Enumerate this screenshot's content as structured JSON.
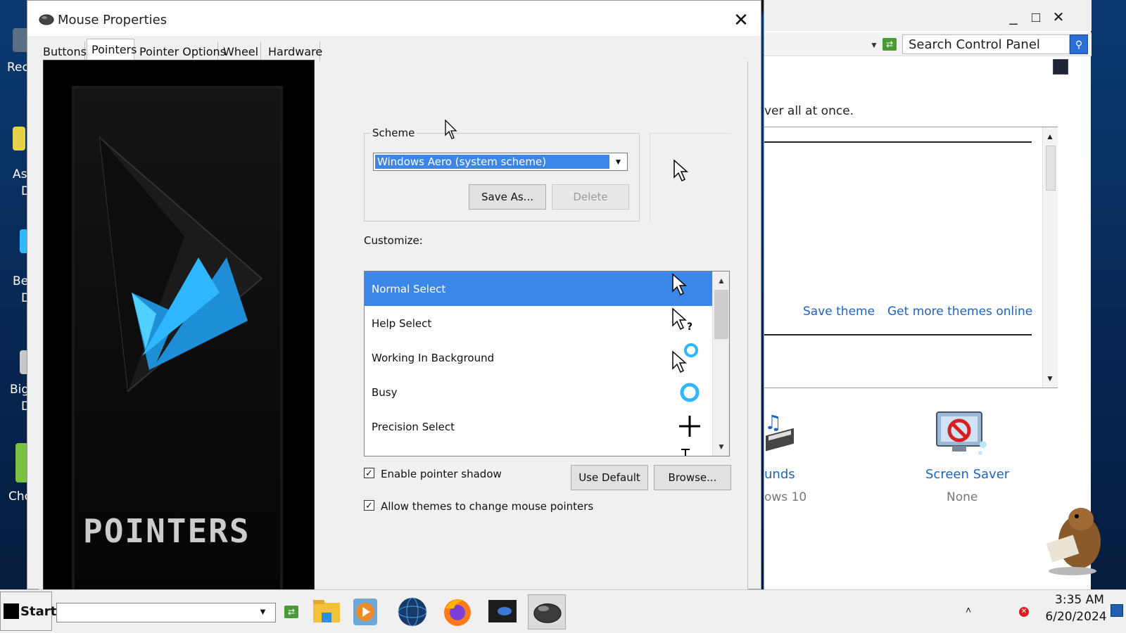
{
  "desktop": {
    "icon_labels": [
      "Rec",
      "As",
      "D",
      "Be",
      "D",
      "Big",
      "D",
      "Cho"
    ]
  },
  "control_panel": {
    "search_placeholder": "Search Control Panel",
    "description": "ver all at once.",
    "save_theme": "Save theme",
    "get_more_themes": "Get more themes online",
    "sounds_label": "unds",
    "sounds_sub": "ows 10",
    "screen_saver_label": "Screen Saver",
    "screen_saver_sub": "None"
  },
  "dialog": {
    "title": "Mouse Properties",
    "tabs": [
      {
        "label": "Buttons",
        "active": false
      },
      {
        "label": "Pointers",
        "active": true
      },
      {
        "label": "Pointer Options",
        "active": false
      },
      {
        "label": "Wheel",
        "active": false
      },
      {
        "label": "Hardware",
        "active": false
      }
    ],
    "art_text": "POINTERS",
    "scheme": {
      "label": "Scheme",
      "value": "Windows Aero (system scheme)",
      "save_as": "Save As...",
      "delete": "Delete"
    },
    "customize_label": "Customize:",
    "cursors": [
      {
        "label": "Normal Select",
        "icon": "arrow-cursor-icon",
        "selected": true
      },
      {
        "label": "Help Select",
        "icon": "help-cursor-icon",
        "selected": false
      },
      {
        "label": "Working In Background",
        "icon": "working-cursor-icon",
        "selected": false
      },
      {
        "label": "Busy",
        "icon": "busy-cursor-icon",
        "selected": false
      },
      {
        "label": "Precision Select",
        "icon": "crosshair-cursor-icon",
        "selected": false
      },
      {
        "label": "",
        "icon": "text-cursor-icon",
        "selected": false
      }
    ],
    "enable_shadow": {
      "label": "Enable pointer shadow",
      "checked": true
    },
    "allow_themes": {
      "label": "Allow themes to change mouse pointers",
      "checked": true
    },
    "use_default": "Use Default",
    "browse": "Browse..."
  },
  "taskbar": {
    "start_label": "Start",
    "time": "3:35 AM",
    "date": "6/20/2024",
    "apps": [
      "file-explorer-icon",
      "media-player-icon",
      "globe-icon",
      "firefox-icon",
      "device-manager-icon",
      "mouse-icon"
    ]
  },
  "colors": {
    "selection": "#3b86e6",
    "link": "#1a64c8",
    "accent_cyan": "#2fb7ff"
  }
}
